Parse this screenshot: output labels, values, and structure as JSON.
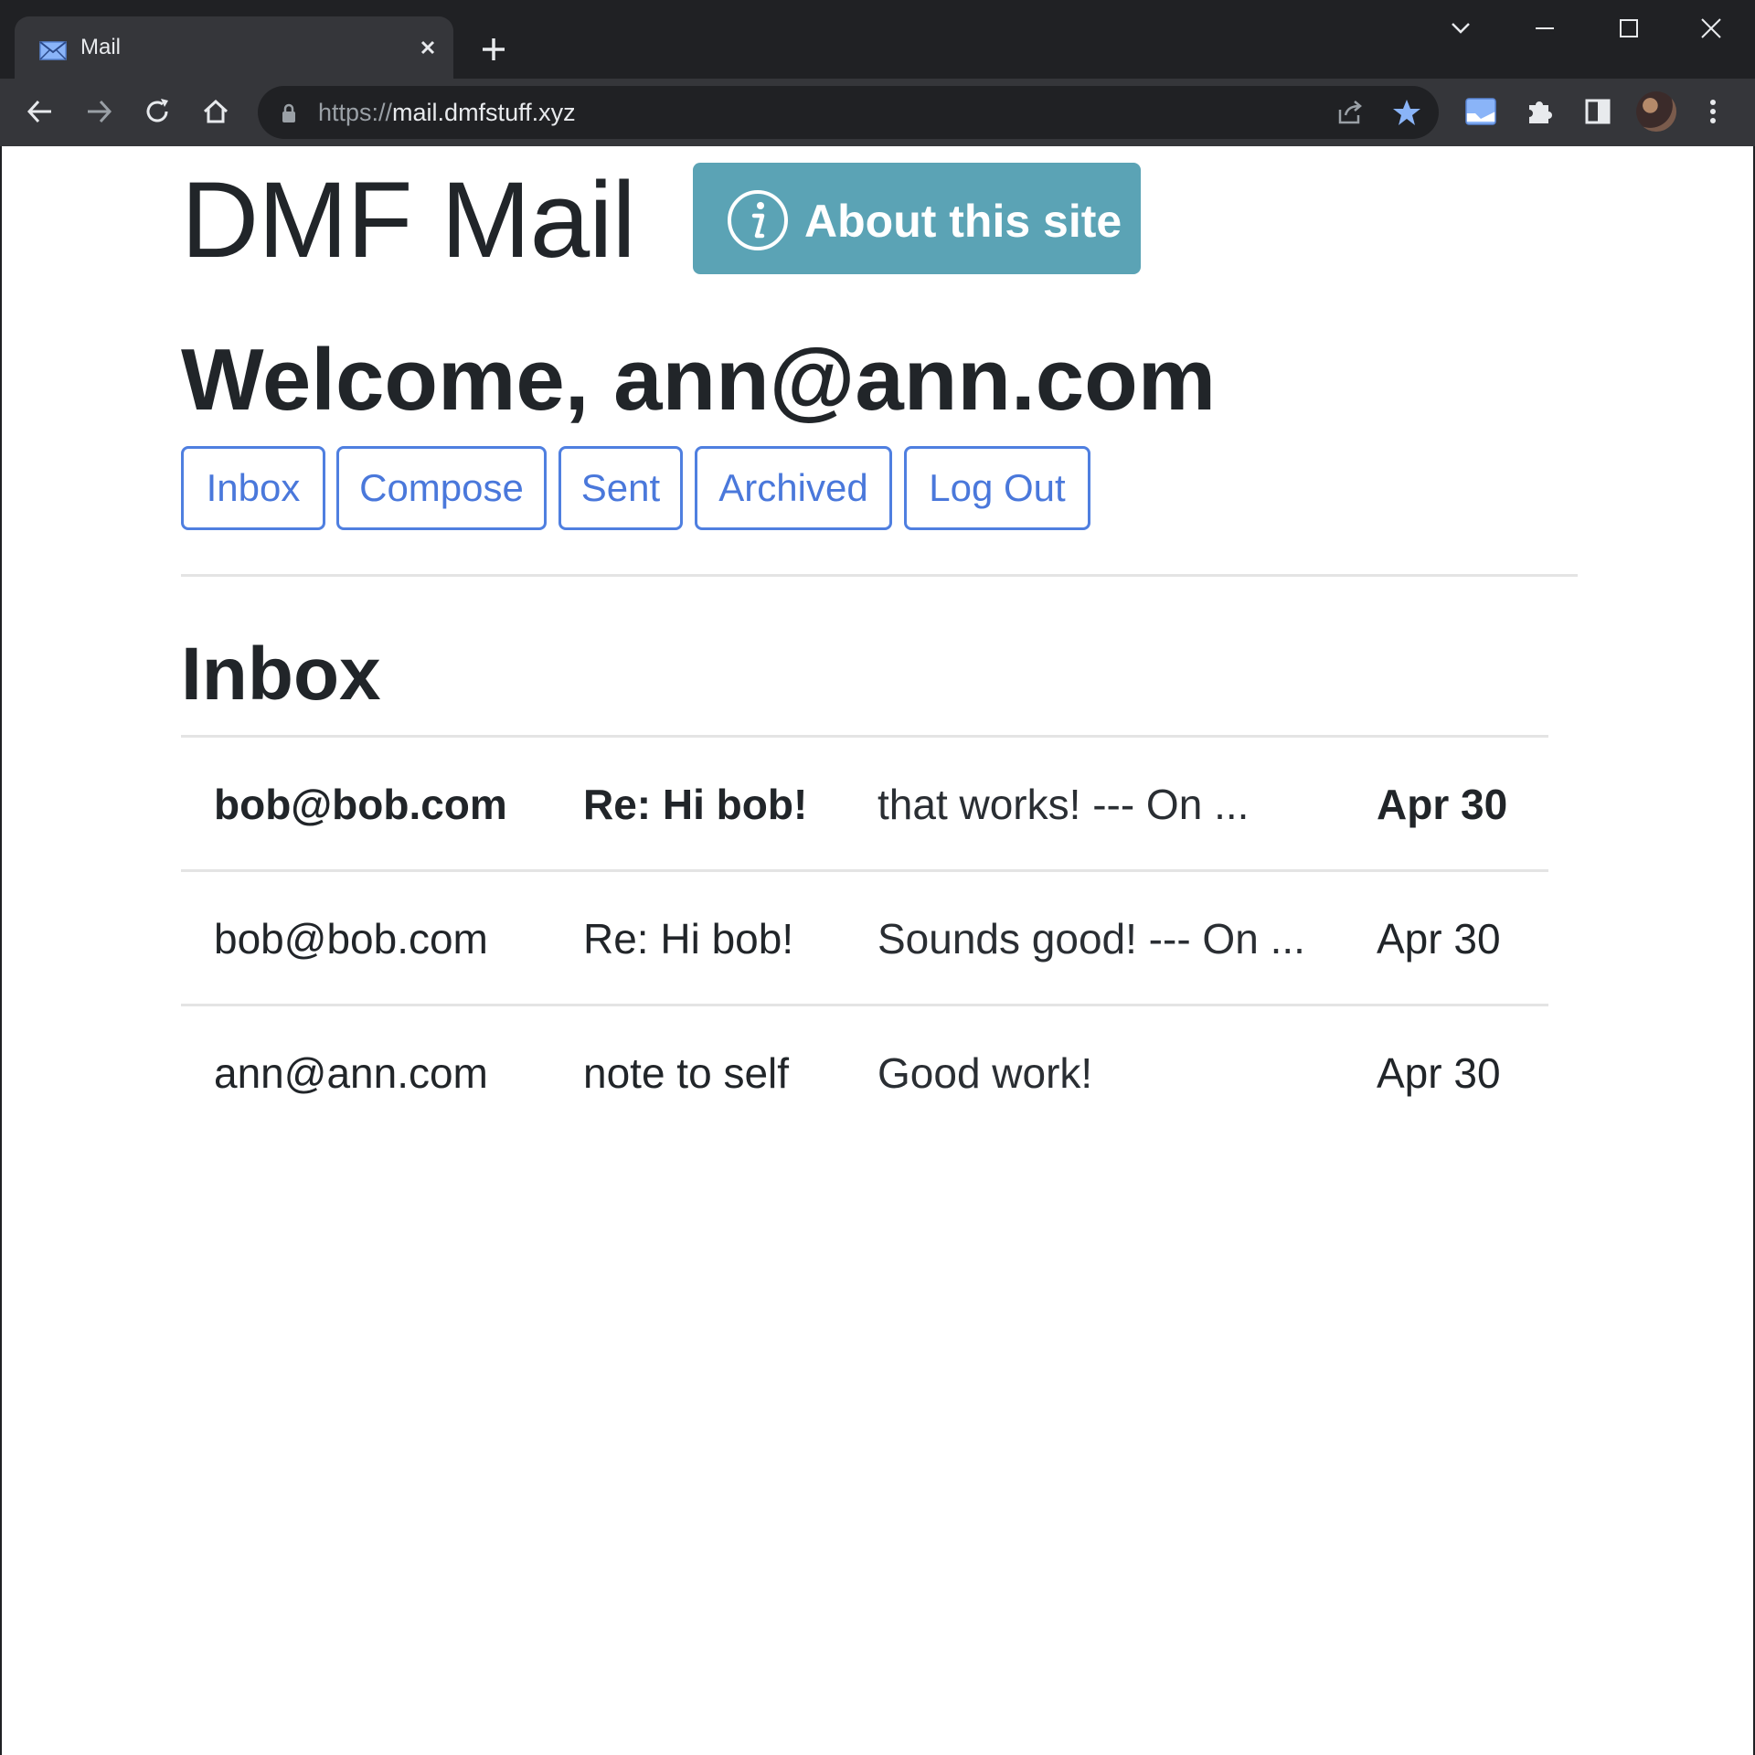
{
  "browser": {
    "tab_title": "Mail",
    "url_scheme": "https://",
    "url_host": "mail.dmfstuff.xyz",
    "icons": [
      "mail-icon",
      "close-icon",
      "plus-icon",
      "chevron-down-icon",
      "minimize-icon",
      "maximize-icon",
      "window-close-icon",
      "back-icon",
      "forward-icon",
      "reload-icon",
      "home-icon",
      "lock-icon",
      "share-icon",
      "star-icon",
      "extension-icon",
      "puzzle-icon",
      "side-panel-icon",
      "avatar",
      "more-icon"
    ],
    "accent_star": "#8ab4f8"
  },
  "site": {
    "title": "DMF Mail",
    "about_label": "About this site",
    "about_color": "#5ba3b5"
  },
  "welcome": "Welcome, ann@ann.com",
  "nav": {
    "inbox": "Inbox",
    "compose": "Compose",
    "sent": "Sent",
    "archived": "Archived",
    "logout": "Log Out",
    "color": "#4a78db"
  },
  "section_title": "Inbox",
  "emails": [
    {
      "sender": "bob@bob.com",
      "subject": "Re: Hi bob!",
      "preview": "that works! --- On ...",
      "date": "Apr 30",
      "unread": true
    },
    {
      "sender": "bob@bob.com",
      "subject": "Re: Hi bob!",
      "preview": "Sounds good! --- On ...",
      "date": "Apr 30",
      "unread": false
    },
    {
      "sender": "ann@ann.com",
      "subject": "note to self",
      "preview": "Good work!",
      "date": "Apr 30",
      "unread": false
    }
  ]
}
